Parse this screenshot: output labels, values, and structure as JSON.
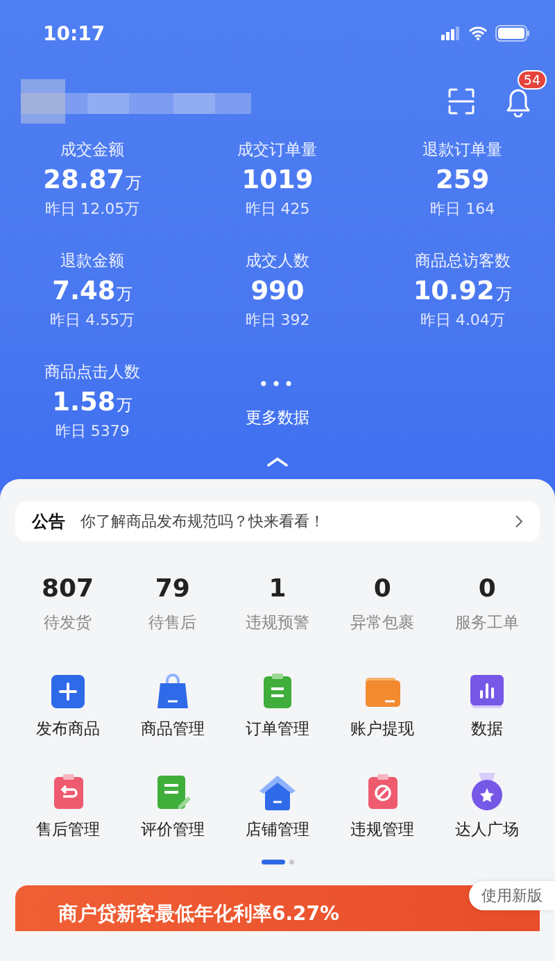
{
  "status_bar": {
    "time": "10:17"
  },
  "header": {
    "notification_count": "54"
  },
  "metrics": [
    {
      "label": "成交金额",
      "value": "28.87",
      "unit": "万",
      "yesterday": "昨日 12.05万"
    },
    {
      "label": "成交订单量",
      "value": "1019",
      "yesterday": "昨日 425"
    },
    {
      "label": "退款订单量",
      "value": "259",
      "yesterday": "昨日 164"
    },
    {
      "label": "退款金额",
      "value": "7.48",
      "unit": "万",
      "yesterday": "昨日 4.55万"
    },
    {
      "label": "成交人数",
      "value": "990",
      "yesterday": "昨日 392"
    },
    {
      "label": "商品总访客数",
      "value": "10.92",
      "unit": "万",
      "yesterday": "昨日 4.04万"
    },
    {
      "label": "商品点击人数",
      "value": "1.58",
      "unit": "万",
      "yesterday": "昨日 5379"
    }
  ],
  "more_data": {
    "dots": "•••",
    "label": "更多数据"
  },
  "notice": {
    "tag": "公告",
    "text": "你了解商品发布规范吗？快来看看！"
  },
  "todo": [
    {
      "count": "807",
      "label": "待发货"
    },
    {
      "count": "79",
      "label": "待售后"
    },
    {
      "count": "1",
      "label": "违规预警"
    },
    {
      "count": "0",
      "label": "异常包裹"
    },
    {
      "count": "0",
      "label": "服务工单"
    }
  ],
  "shortcuts": [
    {
      "kind": "plus",
      "color": "#2f6ae8",
      "label": "发布商品"
    },
    {
      "kind": "bag",
      "color": "#2f6ae8",
      "label": "商品管理"
    },
    {
      "kind": "clipboard",
      "color": "#3fae3a",
      "label": "订单管理"
    },
    {
      "kind": "folder",
      "color": "#f28a30",
      "label": "账户提现"
    },
    {
      "kind": "chart",
      "color": "#7658e6",
      "label": "数据"
    },
    {
      "kind": "return",
      "color": "#ee5a6e",
      "label": "售后管理"
    },
    {
      "kind": "edit",
      "color": "#3fae3a",
      "label": "评价管理"
    },
    {
      "kind": "house",
      "color": "#2f6ae8",
      "label": "店铺管理"
    },
    {
      "kind": "ban",
      "color": "#ee5a6e",
      "label": "违规管理"
    },
    {
      "kind": "medal",
      "color": "#7658e6",
      "label": "达人广场"
    }
  ],
  "pager": [
    {
      "selected": true
    },
    {
      "selected": false
    }
  ],
  "new_version_button": "使用新版",
  "banner": {
    "text": "商户贷新客最低年化利率6.27%"
  }
}
